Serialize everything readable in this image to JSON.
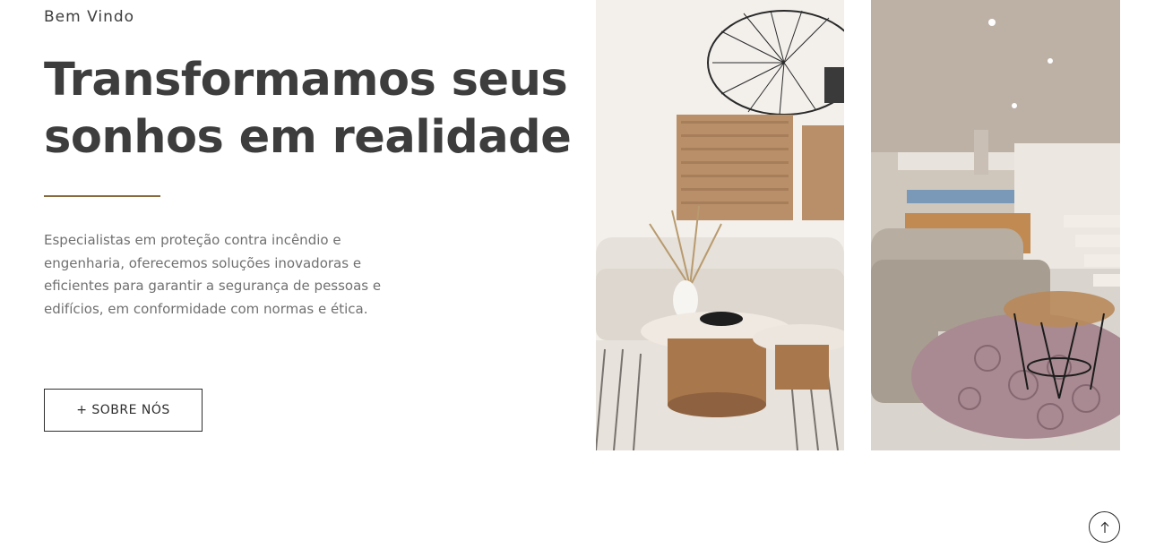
{
  "hero": {
    "eyebrow": "Bem Vindo",
    "title_lines": [
      "Transformamos seus",
      "sonhos em realidade"
    ],
    "description_lines": [
      "Especialistas em proteção contra incêndio e",
      "engenharia, oferecemos soluções inovadoras e",
      "eficientes para garantir a segurança de pessoas e",
      "edifícios, em conformidade com normas e ética."
    ],
    "button_label": "+ SOBRE NÓS"
  },
  "gallery": {
    "images": [
      {
        "name": "living-room-photo",
        "description_icon": "image"
      },
      {
        "name": "sofa-lounge-photo",
        "description_icon": "image"
      }
    ]
  },
  "colors": {
    "accent": "#8a6a3d",
    "heading": "#3d3d3d",
    "body_text": "#707070"
  },
  "icons": {
    "scroll_top": "arrow-up-icon"
  }
}
